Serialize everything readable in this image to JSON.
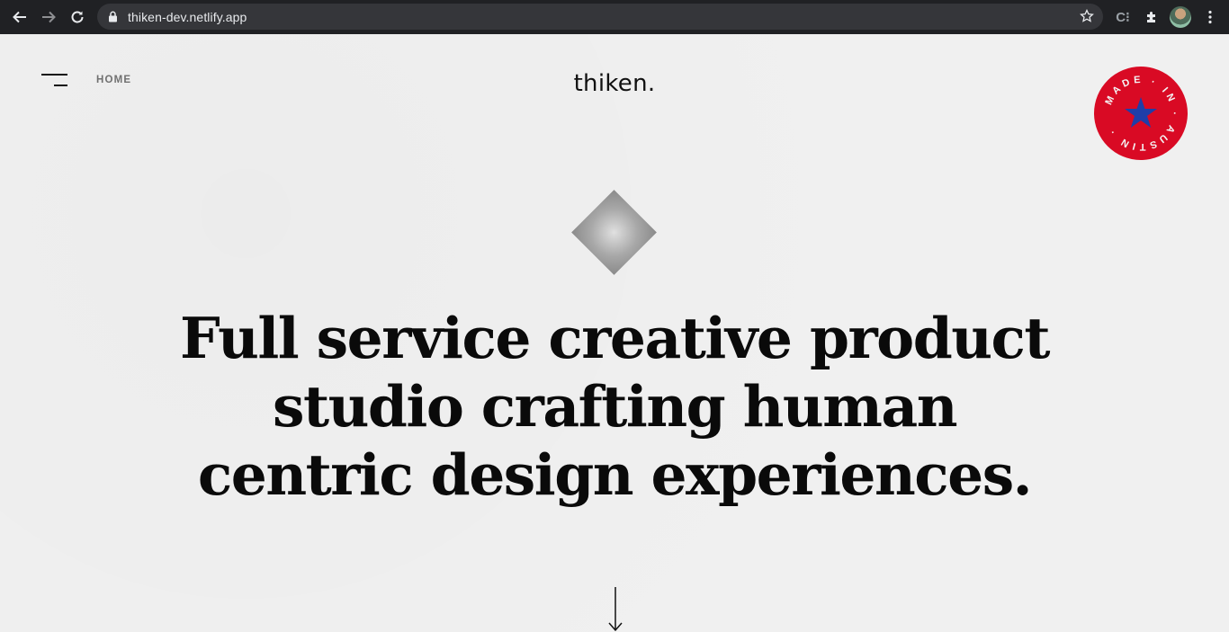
{
  "browser": {
    "url": "thiken-dev.netlify.app",
    "extension_label": "C⁝"
  },
  "nav": {
    "home_label": "HOME"
  },
  "brand": {
    "logo_text": "thiken.",
    "badge_text": "MADE · IN · AUSTIN ·",
    "badge_color": "#d90a24",
    "badge_star_color": "#1f3ea8"
  },
  "hero": {
    "headline": "Full service creative product studio crafting human centric design experiences."
  }
}
